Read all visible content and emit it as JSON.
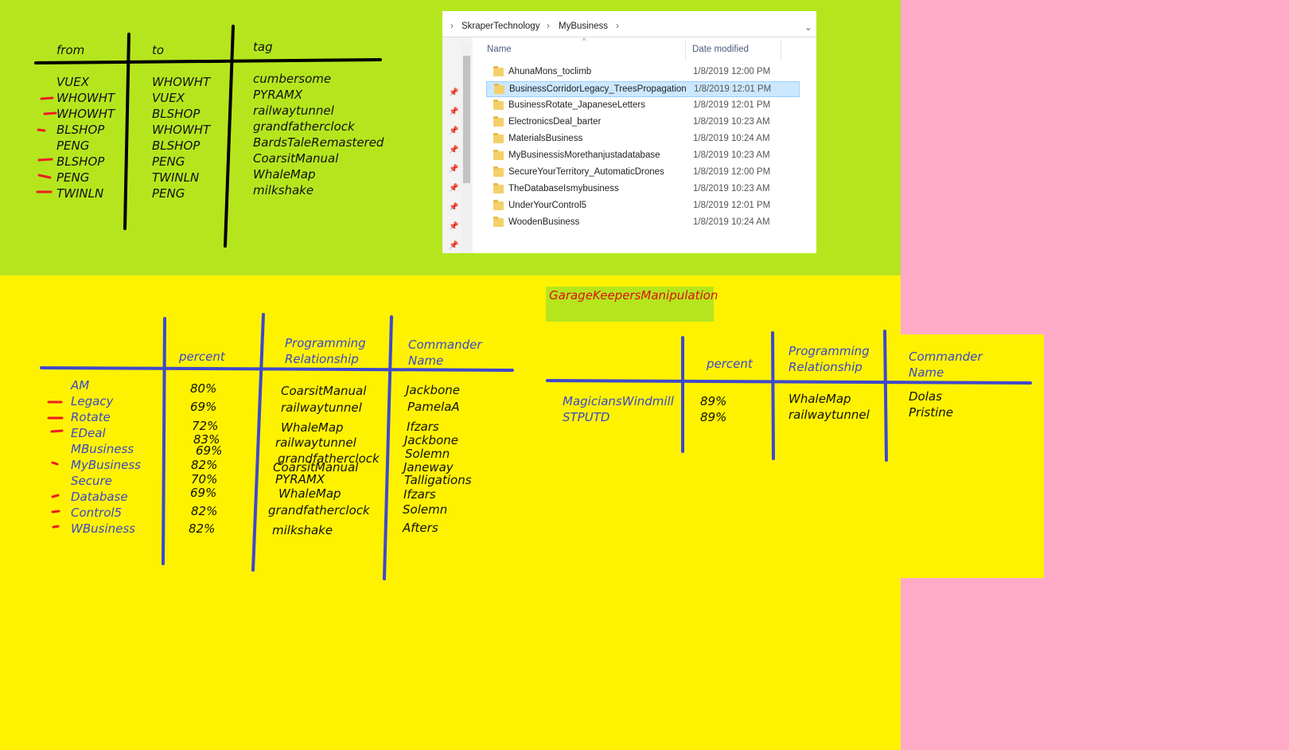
{
  "colors": {
    "pink_bg": "#ffabc8",
    "green_panel": "#b5e61d",
    "yellow_panel": "#fff200",
    "blue_ink": "#3f48cc",
    "red_ink": "#ed1c24",
    "explorer_selection": "#cce8ff"
  },
  "top_table": {
    "headers": {
      "from": "from",
      "to": "to",
      "tag": "tag"
    },
    "rows": [
      {
        "from": "VUEX",
        "to": "WHOWHT",
        "tag": "cumbersome",
        "marked": false
      },
      {
        "from": "WHOWHT",
        "to": "VUEX",
        "tag": "PYRAMX",
        "marked": true
      },
      {
        "from": "WHOWHT",
        "to": "BLSHOP",
        "tag": "railwaytunnel",
        "marked": true
      },
      {
        "from": "BLSHOP",
        "to": "WHOWHT",
        "tag": "grandfatherclock",
        "marked": true
      },
      {
        "from": "PENG",
        "to": "BLSHOP",
        "tag": "BardsTaleRemastered",
        "marked": false
      },
      {
        "from": "BLSHOP",
        "to": "PENG",
        "tag": "CoarsitManual",
        "marked": true
      },
      {
        "from": "PENG",
        "to": "TWINLN",
        "tag": "WhaleMap",
        "marked": true
      },
      {
        "from": "TWINLN",
        "to": "PENG",
        "tag": "milkshake",
        "marked": true
      }
    ]
  },
  "explorer": {
    "breadcrumb": [
      "SkraperTechnology",
      "MyBusiness"
    ],
    "columns": {
      "name": "Name",
      "date": "Date modified"
    },
    "files": [
      {
        "name": "AhunaMons_toclimb",
        "date": "1/8/2019 12:00 PM",
        "selected": false
      },
      {
        "name": "BusinessCorridorLegacy_TreesPropagation",
        "date": "1/8/2019 12:01 PM",
        "selected": true
      },
      {
        "name": "BusinessRotate_JapaneseLetters",
        "date": "1/8/2019 12:01 PM",
        "selected": false
      },
      {
        "name": "ElectronicsDeal_barter",
        "date": "1/8/2019 10:23 AM",
        "selected": false
      },
      {
        "name": "MaterialsBusiness",
        "date": "1/8/2019 10:24 AM",
        "selected": false
      },
      {
        "name": "MyBusinessisMorethanjustadatabase",
        "date": "1/8/2019 10:23 AM",
        "selected": false
      },
      {
        "name": "SecureYourTerritory_AutomaticDrones",
        "date": "1/8/2019 12:00 PM",
        "selected": false
      },
      {
        "name": "TheDatabaseIsmybusiness",
        "date": "1/8/2019 10:23 AM",
        "selected": false
      },
      {
        "name": "UnderYourControl5",
        "date": "1/8/2019 12:01 PM",
        "selected": false
      },
      {
        "name": "WoodenBusiness",
        "date": "1/8/2019 10:24 AM",
        "selected": false
      }
    ]
  },
  "left_table": {
    "headers": {
      "percent": "percent",
      "prog_line1": "Programming",
      "prog_line2": "Relationship",
      "cmd_line1": "Commander",
      "cmd_line2": "Name"
    },
    "names": [
      {
        "text": "AM",
        "marked": false
      },
      {
        "text": "Legacy",
        "marked": true
      },
      {
        "text": "Rotate",
        "marked": true
      },
      {
        "text": "EDeal",
        "marked": true
      },
      {
        "text": "MBusiness",
        "marked": false
      },
      {
        "text": "MyBusiness",
        "marked": true
      },
      {
        "text": "Secure",
        "marked": false
      },
      {
        "text": "Database",
        "marked": true
      },
      {
        "text": "Control5",
        "marked": true
      },
      {
        "text": "WBusiness",
        "marked": true
      }
    ],
    "percents": [
      "80%",
      "69%",
      "72%",
      "83%",
      "69%",
      "82%",
      "70%",
      "69%",
      "82%",
      "82%"
    ],
    "programs": [
      "CoarsitManual",
      "railwaytunnel",
      "WhaleMap",
      "railwaytunnel",
      "grandfatherclock",
      "CoarsitManual",
      "PYRAMX",
      "WhaleMap",
      "grandfatherclock",
      "milkshake"
    ],
    "commanders": [
      "Jackbone",
      "PamelaA",
      "Ifzars",
      "Jackbone",
      "Solemn",
      "Janeway",
      "Talligations",
      "Ifzars",
      "Solemn",
      "Afters"
    ]
  },
  "right_table": {
    "title": "GarageKeepersManipulation",
    "headers": {
      "percent": "percent",
      "prog_line1": "Programming",
      "prog_line2": "Relationship",
      "cmd_line1": "Commander",
      "cmd_line2": "Name"
    },
    "names": [
      "MagiciansWindmill",
      "STPUTD"
    ],
    "percents": [
      "89%",
      "89%"
    ],
    "programs": [
      "WhaleMap",
      "railwaytunnel"
    ],
    "commanders": [
      "Dolas",
      "Pristine"
    ]
  }
}
